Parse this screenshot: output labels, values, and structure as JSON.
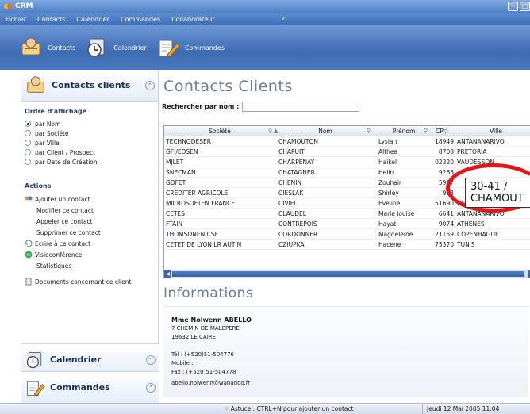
{
  "app": {
    "title": "CRM"
  },
  "menu": [
    "Fichier",
    "Contacts",
    "Calendrier",
    "Commandes",
    "Collaborateur",
    "?"
  ],
  "toolbar": {
    "contacts": "Contacts",
    "calendrier": "Calendrier",
    "commandes": "Commandes"
  },
  "sidebar": {
    "title": "Contacts clients",
    "order_heading": "Ordre d'affichage",
    "order_options": [
      "par Nom",
      "par Société",
      "par Ville",
      "par Client / Prospect",
      "par Date de Création"
    ],
    "actions_heading": "Actions",
    "actions": [
      "Ajouter un contact",
      "Modifier ce contact",
      "Appeler ce contact",
      "Supprimer ce contact",
      "Ecrire à ce contact",
      "Visioconférence",
      "Statistiques"
    ],
    "documents": "Documents concernant ce client",
    "calendrier": "Calendrier",
    "commandes": "Commandes"
  },
  "main": {
    "title": "Contacts Clients",
    "search_label": "Rechercher par nom :",
    "columns": [
      "Société",
      "Nom",
      "Prénom",
      "CP",
      "Ville"
    ],
    "rows": [
      [
        "TECHNODESER",
        "CHAMOUTON",
        "Lysian",
        "18949",
        "ANTANANARIVO"
      ],
      [
        "GFI/EDSEN",
        "CHAPUIT",
        "Althea",
        "8708",
        "PRETORIA"
      ],
      [
        "MJLET",
        "CHARPENAY",
        "Haikel",
        "02320",
        "VAUDESSON"
      ],
      [
        "SNECMAN",
        "CHATAGNER",
        "Helin",
        "9265",
        ""
      ],
      [
        "GDFET",
        "CHENIN",
        "Zouhair",
        "5957",
        ""
      ],
      [
        "CREDITER AGRICOLE",
        "CIESLAK",
        "Shirley",
        "983",
        ""
      ],
      [
        "MICROSOFTEN FRANCE",
        "CIVIEL",
        "Eveline",
        "51690",
        "GENT"
      ],
      [
        "CETES",
        "CLAUDEL",
        "Marie louise",
        "6641",
        "ANTANANARIVO"
      ],
      [
        "FTAIN",
        "CONTREPOIS",
        "Hayat",
        "9074",
        "ATHENES"
      ],
      [
        "THOMSONEN CSF",
        "CORDONNER",
        "Magdeleine",
        "21159",
        "COPENHAGUE"
      ],
      [
        "CETET DE LYON LR AUTIN",
        "CZIUPKA",
        "Hacene",
        "75370",
        "TUNIS"
      ]
    ],
    "callout_line1": "30-41 /",
    "callout_line2": "CHAMOUT",
    "info_title": "Informations",
    "info": {
      "name": "Mme Nolwenn ABELLO",
      "address1": "7 CHEMIN DE MALEPERE",
      "address2": "19632 LE CAIRE",
      "tel": "Tél : (+520)51-504776",
      "mobile": "Mobile :",
      "fax": "Fax : (+520)51-504778",
      "email": "abello.nolwenn@wanadoo.fr"
    }
  },
  "status": {
    "tip": "Astuce : CTRL+N pour ajouter un contact",
    "date": "Jeudi 12 Mai 2005 11:04"
  },
  "colors": {
    "accent": "#3e6fb8",
    "highlight": "#e2151b"
  }
}
